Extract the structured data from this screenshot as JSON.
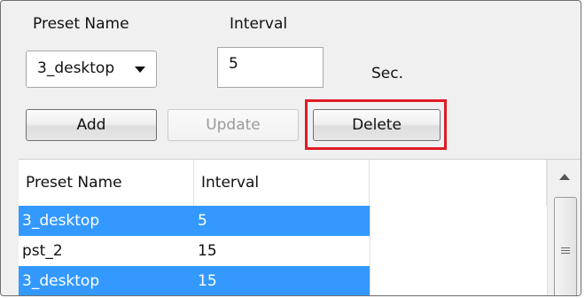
{
  "form": {
    "preset_name_label": "Preset Name",
    "interval_label": "Interval",
    "preset_selected": "3_desktop",
    "interval_value": "5",
    "unit_label": "Sec."
  },
  "buttons": {
    "add": "Add",
    "update": "Update",
    "delete": "Delete"
  },
  "table": {
    "columns": [
      "Preset Name",
      "Interval"
    ],
    "rows": [
      {
        "name": "3_desktop",
        "interval": "5",
        "selected": true
      },
      {
        "name": "pst_2",
        "interval": "15",
        "selected": false
      },
      {
        "name": "3_desktop",
        "interval": "15",
        "selected": true
      }
    ]
  },
  "colors": {
    "selection": "#3399ff",
    "highlight_box": "#e01b24"
  }
}
